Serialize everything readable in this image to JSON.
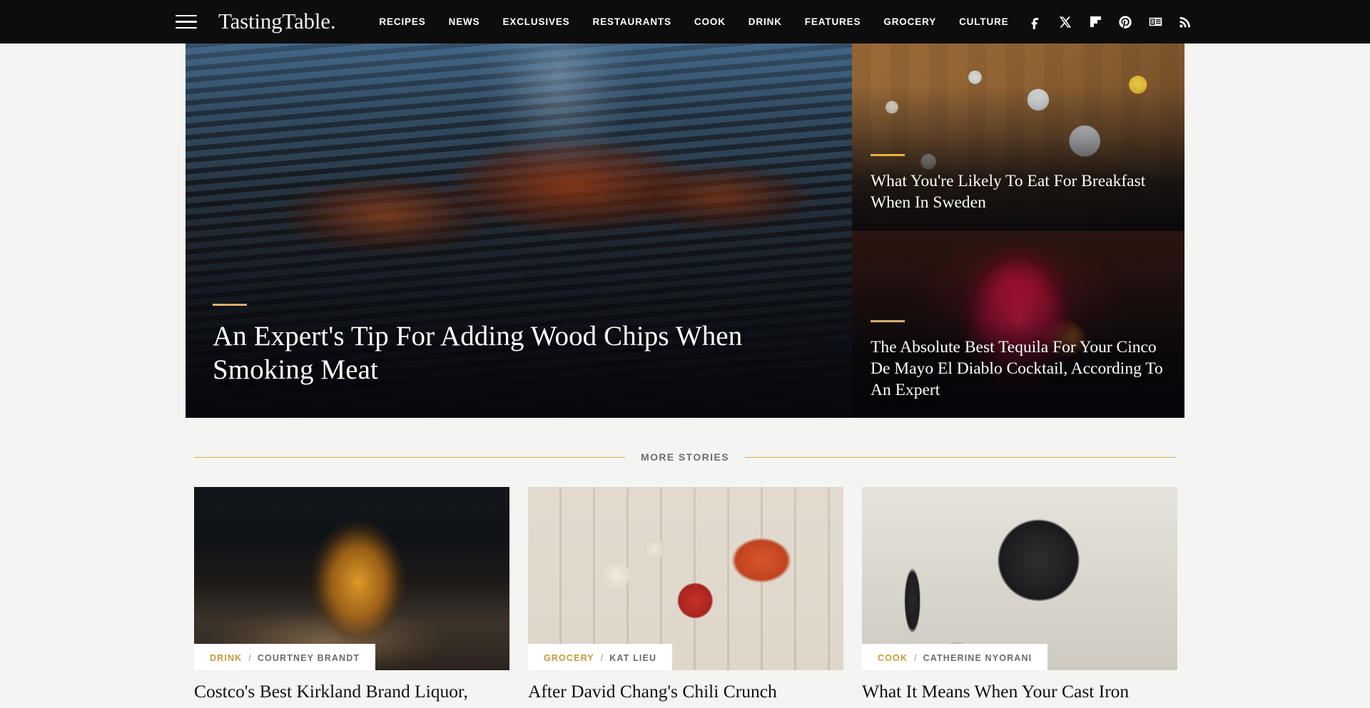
{
  "site": {
    "brand": "TastingTable.",
    "menu_icon": "hamburger-menu-icon"
  },
  "nav": {
    "items": [
      {
        "label": "RECIPES"
      },
      {
        "label": "NEWS"
      },
      {
        "label": "EXCLUSIVES"
      },
      {
        "label": "RESTAURANTS"
      },
      {
        "label": "COOK"
      },
      {
        "label": "DRINK"
      },
      {
        "label": "FEATURES"
      },
      {
        "label": "GROCERY"
      },
      {
        "label": "CULTURE"
      }
    ]
  },
  "social": {
    "items": [
      {
        "icon": "facebook-icon",
        "name": "Facebook"
      },
      {
        "icon": "x-twitter-icon",
        "name": "X"
      },
      {
        "icon": "flipboard-icon",
        "name": "Flipboard"
      },
      {
        "icon": "pinterest-icon",
        "name": "Pinterest"
      },
      {
        "icon": "google-news-icon",
        "name": "Google News"
      },
      {
        "icon": "rss-icon",
        "name": "RSS"
      }
    ]
  },
  "hero": {
    "featured": {
      "title": "An Expert's Tip For Adding Wood Chips When Smoking Meat",
      "image_desc": "tongs-placing-ribs-on-grill"
    },
    "side_cards": [
      {
        "title": "What You're Likely To Eat For Breakfast When In Sweden",
        "image_desc": "swedish-breakfast-spread-overhead"
      },
      {
        "title": "The Absolute Best Tequila For Your Cinco De Mayo El Diablo Cocktail, According To An Expert",
        "image_desc": "red-el-diablo-cocktail-in-glass"
      }
    ]
  },
  "more_stories": {
    "section_label": "MORE STORIES",
    "cards": [
      {
        "category": "DRINK",
        "separator": "/",
        "author": "COURTNEY BRANDT",
        "title": "Costco's Best Kirkland Brand Liquor,",
        "image_desc": "whiskey-glass-with-ice-on-barrel"
      },
      {
        "category": "GROCERY",
        "separator": "/",
        "author": "KAT LIEU",
        "title": "After David Chang's Chili Crunch",
        "image_desc": "chili-crunch-jar-with-eggs-and-skillet"
      },
      {
        "category": "COOK",
        "separator": "/",
        "author": "CATHERINE NYORANI",
        "title": "What It Means When Your Cast Iron",
        "image_desc": "black-cast-iron-skillet-on-white-surface"
      }
    ]
  },
  "colors": {
    "header_bg": "#0d0d0d",
    "page_bg": "#f4f4f3",
    "accent_gold": "#d7b06a",
    "accent_gold_bright": "#e8b33e",
    "divider_gold": "#d9ab55",
    "category_gold": "#c79a3c",
    "author_gray": "#6b6b6b",
    "text_dark": "#111111",
    "text_light": "#ffffff"
  }
}
